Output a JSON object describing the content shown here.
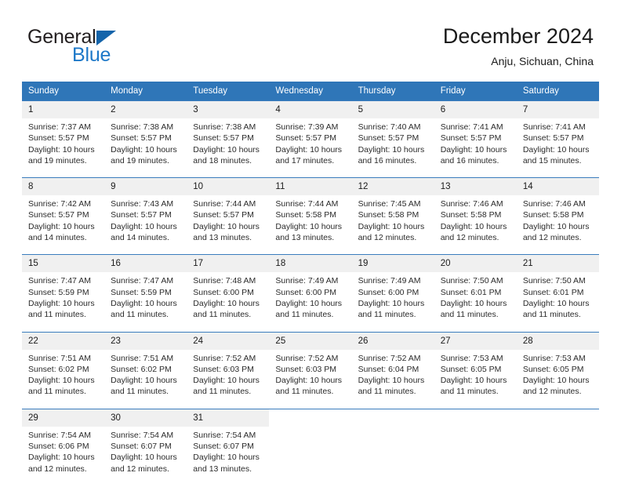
{
  "brand": {
    "name_part1": "General",
    "name_part2": "Blue",
    "triangle_color": "#1464aa",
    "blue_color": "#1d78c8"
  },
  "header": {
    "title": "December 2024",
    "subtitle": "Anju, Sichuan, China"
  },
  "theme": {
    "header_bg": "#2f76b8",
    "daynum_bg": "#f0f0f0",
    "row_divider": "#3a7cbd"
  },
  "weekday_headers": [
    "Sunday",
    "Monday",
    "Tuesday",
    "Wednesday",
    "Thursday",
    "Friday",
    "Saturday"
  ],
  "weeks": [
    {
      "days": [
        {
          "num": "1",
          "sunrise": "Sunrise: 7:37 AM",
          "sunset": "Sunset: 5:57 PM",
          "daylight1": "Daylight: 10 hours",
          "daylight2": "and 19 minutes."
        },
        {
          "num": "2",
          "sunrise": "Sunrise: 7:38 AM",
          "sunset": "Sunset: 5:57 PM",
          "daylight1": "Daylight: 10 hours",
          "daylight2": "and 19 minutes."
        },
        {
          "num": "3",
          "sunrise": "Sunrise: 7:38 AM",
          "sunset": "Sunset: 5:57 PM",
          "daylight1": "Daylight: 10 hours",
          "daylight2": "and 18 minutes."
        },
        {
          "num": "4",
          "sunrise": "Sunrise: 7:39 AM",
          "sunset": "Sunset: 5:57 PM",
          "daylight1": "Daylight: 10 hours",
          "daylight2": "and 17 minutes."
        },
        {
          "num": "5",
          "sunrise": "Sunrise: 7:40 AM",
          "sunset": "Sunset: 5:57 PM",
          "daylight1": "Daylight: 10 hours",
          "daylight2": "and 16 minutes."
        },
        {
          "num": "6",
          "sunrise": "Sunrise: 7:41 AM",
          "sunset": "Sunset: 5:57 PM",
          "daylight1": "Daylight: 10 hours",
          "daylight2": "and 16 minutes."
        },
        {
          "num": "7",
          "sunrise": "Sunrise: 7:41 AM",
          "sunset": "Sunset: 5:57 PM",
          "daylight1": "Daylight: 10 hours",
          "daylight2": "and 15 minutes."
        }
      ]
    },
    {
      "days": [
        {
          "num": "8",
          "sunrise": "Sunrise: 7:42 AM",
          "sunset": "Sunset: 5:57 PM",
          "daylight1": "Daylight: 10 hours",
          "daylight2": "and 14 minutes."
        },
        {
          "num": "9",
          "sunrise": "Sunrise: 7:43 AM",
          "sunset": "Sunset: 5:57 PM",
          "daylight1": "Daylight: 10 hours",
          "daylight2": "and 14 minutes."
        },
        {
          "num": "10",
          "sunrise": "Sunrise: 7:44 AM",
          "sunset": "Sunset: 5:57 PM",
          "daylight1": "Daylight: 10 hours",
          "daylight2": "and 13 minutes."
        },
        {
          "num": "11",
          "sunrise": "Sunrise: 7:44 AM",
          "sunset": "Sunset: 5:58 PM",
          "daylight1": "Daylight: 10 hours",
          "daylight2": "and 13 minutes."
        },
        {
          "num": "12",
          "sunrise": "Sunrise: 7:45 AM",
          "sunset": "Sunset: 5:58 PM",
          "daylight1": "Daylight: 10 hours",
          "daylight2": "and 12 minutes."
        },
        {
          "num": "13",
          "sunrise": "Sunrise: 7:46 AM",
          "sunset": "Sunset: 5:58 PM",
          "daylight1": "Daylight: 10 hours",
          "daylight2": "and 12 minutes."
        },
        {
          "num": "14",
          "sunrise": "Sunrise: 7:46 AM",
          "sunset": "Sunset: 5:58 PM",
          "daylight1": "Daylight: 10 hours",
          "daylight2": "and 12 minutes."
        }
      ]
    },
    {
      "days": [
        {
          "num": "15",
          "sunrise": "Sunrise: 7:47 AM",
          "sunset": "Sunset: 5:59 PM",
          "daylight1": "Daylight: 10 hours",
          "daylight2": "and 11 minutes."
        },
        {
          "num": "16",
          "sunrise": "Sunrise: 7:47 AM",
          "sunset": "Sunset: 5:59 PM",
          "daylight1": "Daylight: 10 hours",
          "daylight2": "and 11 minutes."
        },
        {
          "num": "17",
          "sunrise": "Sunrise: 7:48 AM",
          "sunset": "Sunset: 6:00 PM",
          "daylight1": "Daylight: 10 hours",
          "daylight2": "and 11 minutes."
        },
        {
          "num": "18",
          "sunrise": "Sunrise: 7:49 AM",
          "sunset": "Sunset: 6:00 PM",
          "daylight1": "Daylight: 10 hours",
          "daylight2": "and 11 minutes."
        },
        {
          "num": "19",
          "sunrise": "Sunrise: 7:49 AM",
          "sunset": "Sunset: 6:00 PM",
          "daylight1": "Daylight: 10 hours",
          "daylight2": "and 11 minutes."
        },
        {
          "num": "20",
          "sunrise": "Sunrise: 7:50 AM",
          "sunset": "Sunset: 6:01 PM",
          "daylight1": "Daylight: 10 hours",
          "daylight2": "and 11 minutes."
        },
        {
          "num": "21",
          "sunrise": "Sunrise: 7:50 AM",
          "sunset": "Sunset: 6:01 PM",
          "daylight1": "Daylight: 10 hours",
          "daylight2": "and 11 minutes."
        }
      ]
    },
    {
      "days": [
        {
          "num": "22",
          "sunrise": "Sunrise: 7:51 AM",
          "sunset": "Sunset: 6:02 PM",
          "daylight1": "Daylight: 10 hours",
          "daylight2": "and 11 minutes."
        },
        {
          "num": "23",
          "sunrise": "Sunrise: 7:51 AM",
          "sunset": "Sunset: 6:02 PM",
          "daylight1": "Daylight: 10 hours",
          "daylight2": "and 11 minutes."
        },
        {
          "num": "24",
          "sunrise": "Sunrise: 7:52 AM",
          "sunset": "Sunset: 6:03 PM",
          "daylight1": "Daylight: 10 hours",
          "daylight2": "and 11 minutes."
        },
        {
          "num": "25",
          "sunrise": "Sunrise: 7:52 AM",
          "sunset": "Sunset: 6:03 PM",
          "daylight1": "Daylight: 10 hours",
          "daylight2": "and 11 minutes."
        },
        {
          "num": "26",
          "sunrise": "Sunrise: 7:52 AM",
          "sunset": "Sunset: 6:04 PM",
          "daylight1": "Daylight: 10 hours",
          "daylight2": "and 11 minutes."
        },
        {
          "num": "27",
          "sunrise": "Sunrise: 7:53 AM",
          "sunset": "Sunset: 6:05 PM",
          "daylight1": "Daylight: 10 hours",
          "daylight2": "and 11 minutes."
        },
        {
          "num": "28",
          "sunrise": "Sunrise: 7:53 AM",
          "sunset": "Sunset: 6:05 PM",
          "daylight1": "Daylight: 10 hours",
          "daylight2": "and 12 minutes."
        }
      ]
    },
    {
      "days": [
        {
          "num": "29",
          "sunrise": "Sunrise: 7:54 AM",
          "sunset": "Sunset: 6:06 PM",
          "daylight1": "Daylight: 10 hours",
          "daylight2": "and 12 minutes."
        },
        {
          "num": "30",
          "sunrise": "Sunrise: 7:54 AM",
          "sunset": "Sunset: 6:07 PM",
          "daylight1": "Daylight: 10 hours",
          "daylight2": "and 12 minutes."
        },
        {
          "num": "31",
          "sunrise": "Sunrise: 7:54 AM",
          "sunset": "Sunset: 6:07 PM",
          "daylight1": "Daylight: 10 hours",
          "daylight2": "and 13 minutes."
        },
        {
          "num": "",
          "sunrise": "",
          "sunset": "",
          "daylight1": "",
          "daylight2": ""
        },
        {
          "num": "",
          "sunrise": "",
          "sunset": "",
          "daylight1": "",
          "daylight2": ""
        },
        {
          "num": "",
          "sunrise": "",
          "sunset": "",
          "daylight1": "",
          "daylight2": ""
        },
        {
          "num": "",
          "sunrise": "",
          "sunset": "",
          "daylight1": "",
          "daylight2": ""
        }
      ]
    }
  ]
}
